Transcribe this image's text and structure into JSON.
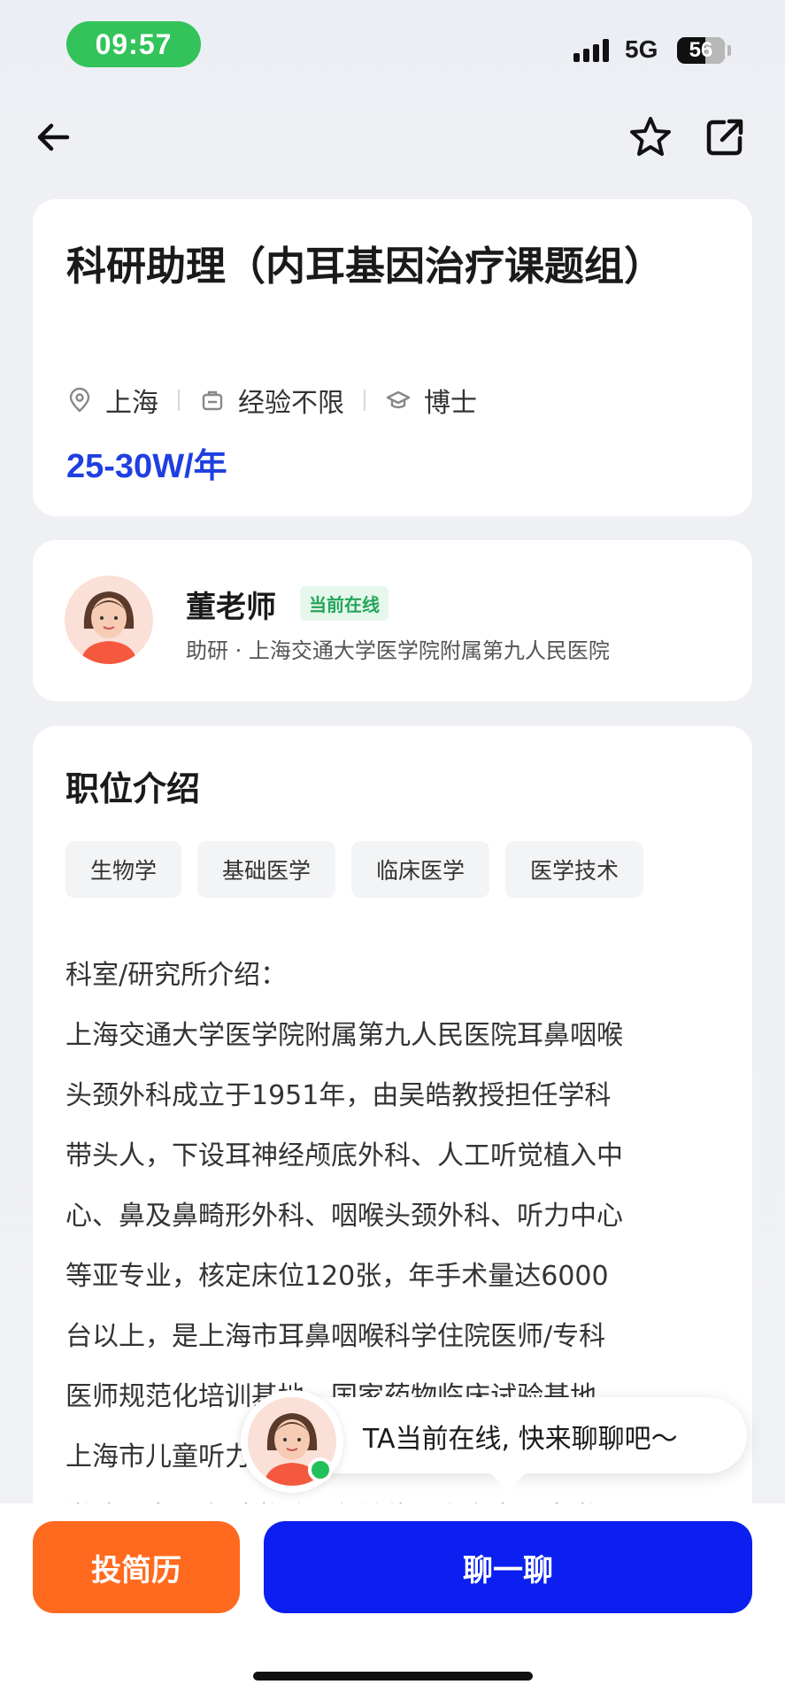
{
  "status_bar": {
    "time": "09:57",
    "network": "5G",
    "battery": "56"
  },
  "nav": {
    "back_icon": "arrow-left-icon",
    "favorite_icon": "star-icon",
    "share_icon": "share-icon"
  },
  "job": {
    "title": "科研助理（内耳基因治疗课题组）",
    "location": "上海",
    "experience": "经验不限",
    "education": "博士",
    "salary": "25-30W/年"
  },
  "recruiter": {
    "name": "董老师",
    "status": "当前在线",
    "subtitle": "助研 · 上海交通大学医学院附属第九人民医院"
  },
  "description": {
    "section_title": "职位介绍",
    "tags": [
      "生物学",
      "基础医学",
      "临床医学",
      "医学技术"
    ],
    "lines": [
      "科室/研究所介绍：",
      "上海交通大学医学院附属第九人民医院耳鼻咽喉",
      "头颈外科成立于1951年，由吴皓教授担任学科",
      "带头人，下设耳神经颅底外科、人工听觉植入中",
      "心、鼻及鼻畸形外科、咽喉头颈外科、听力中心",
      "等亚专业，核定床位120张，年手术量达6000",
      "台以上，是上海市耳鼻咽喉科学住院医师/专科",
      "医师规范化培训基地、国家药物临床试验基地、",
      "上海市儿童听力障碍诊治中心、上海交通大学医",
      "学院耳鼻咽喉科学系所在单位，上海交通大学医"
    ]
  },
  "chat_prompt": {
    "text": "TA当前在线, 快来聊聊吧～"
  },
  "actions": {
    "apply_label": "投简历",
    "chat_label": "聊一聊"
  },
  "colors": {
    "accent_blue": "#0a1ff0",
    "salary_blue": "#1f3fe0",
    "apply_orange": "#ff6a1f",
    "online_green": "#22c05a"
  }
}
